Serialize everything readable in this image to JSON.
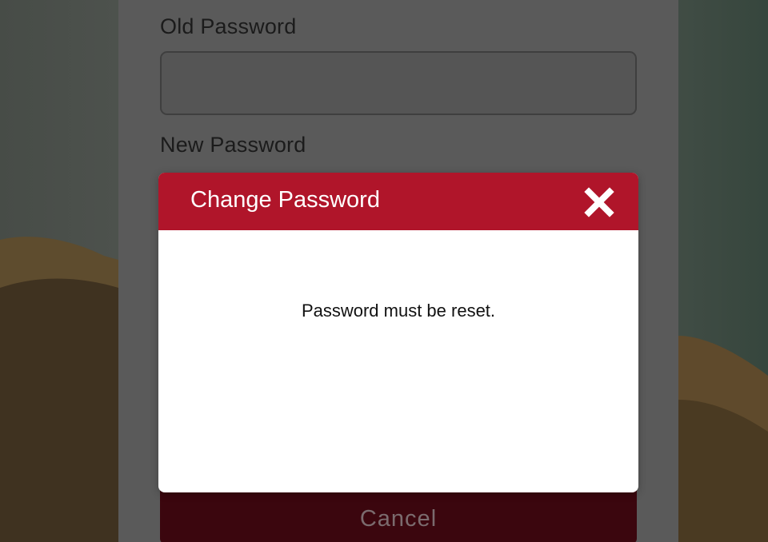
{
  "form": {
    "old_password_label": "Old Password",
    "old_password_value": "",
    "new_password_label": "New Password",
    "cancel_label": "Cancel"
  },
  "modal": {
    "title": "Change Password",
    "message": "Password must be reset.",
    "close_icon": "close-icon"
  },
  "colors": {
    "header_red": "#b0152a",
    "cancel_dark_red": "#3b060e",
    "overlay_panel": "#5a5a5a"
  }
}
